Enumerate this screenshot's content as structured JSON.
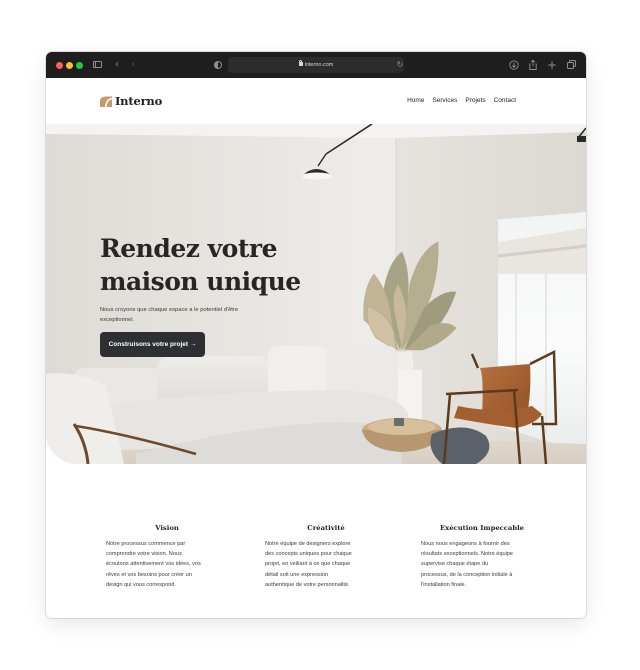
{
  "browser": {
    "address": "interno.com",
    "icons": [
      "sidebar-icon",
      "back-icon",
      "forward-icon",
      "privacy-icon",
      "lock-icon",
      "reload-icon",
      "download-icon",
      "share-icon",
      "new-tab-icon",
      "tabs-icon"
    ]
  },
  "site": {
    "logo": "Interno",
    "nav": [
      "Home",
      "Services",
      "Projets",
      "Contact"
    ]
  },
  "hero": {
    "title_lines": [
      "Rendez votre",
      "maison unique"
    ],
    "subtitle_lines": [
      "Nous croyons que chaque espace a le potentiel d'être",
      "exceptionnel."
    ],
    "cta": "Construisons votre projet →"
  },
  "features": [
    {
      "title": "Vision",
      "lines": [
        "Notre processus commence par",
        "comprendre votre vision. Nous",
        "écoutons attentivement vos idées, vos",
        "rêves et vos besoins pour créer un",
        "design qui vous correspond."
      ]
    },
    {
      "title": "Créativité",
      "lines": [
        "Notre équipe de designers explore",
        "des concepts uniques pour chaque",
        "projet, en veillant à ce que chaque",
        "détail soit une expression",
        "authentique de votre personnalité."
      ]
    },
    {
      "title": "Exécution Impeccable",
      "lines": [
        "Nous nous engageons à fournir des",
        "résultats exceptionnels. Notre équipe",
        "supervise chaque étape du",
        "processus, de la conception initiale à",
        "l'installation finale."
      ]
    }
  ],
  "colors": {
    "logo_accent": "#c49a6c",
    "chrome_bg": "#1e1e1f",
    "cta_bg": "#2d2f33",
    "text_dark": "#1f1f1f"
  }
}
